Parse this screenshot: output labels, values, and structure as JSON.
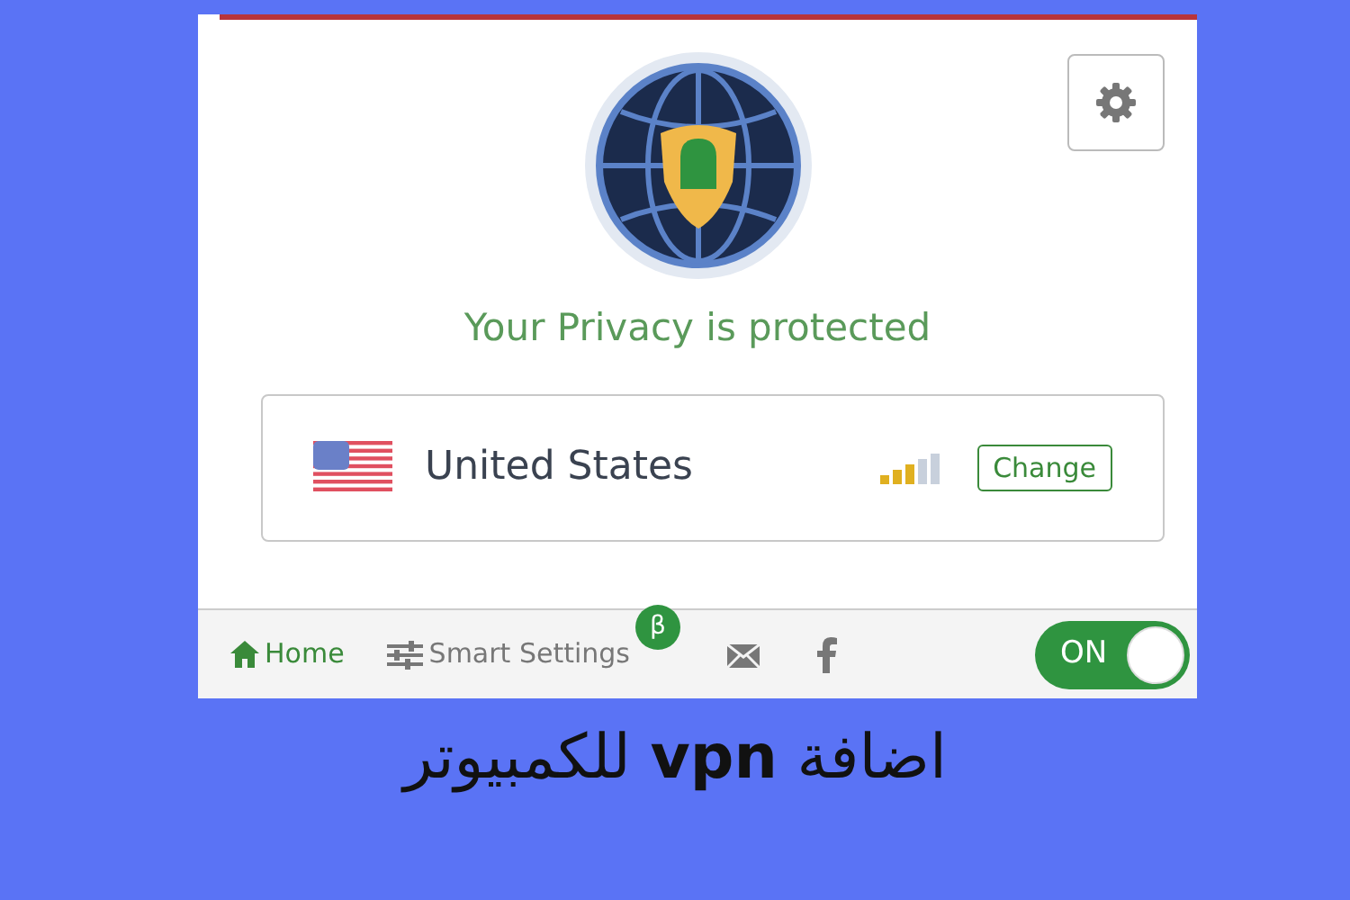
{
  "extension": {
    "status": "Your Privacy is protected",
    "location": {
      "country": "United States",
      "change_button": "Change"
    },
    "footer": {
      "nav": [
        {
          "label": "Home",
          "selected": true
        },
        {
          "label": "Smart Settings",
          "selected": false,
          "badge": "β"
        }
      ],
      "toggle": {
        "label": "ON",
        "on": true
      }
    }
  },
  "caption": "اضافة **vpn** للكمبيوتر"
}
